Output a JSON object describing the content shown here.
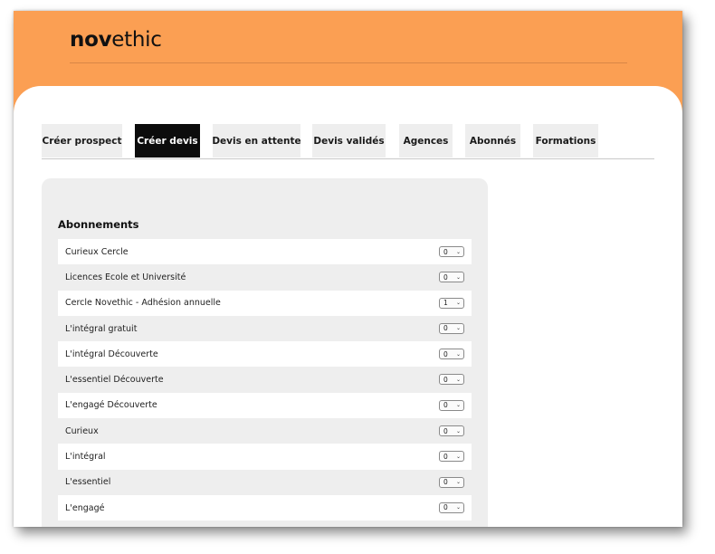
{
  "brand": {
    "logo_bold": "nov",
    "logo_rest": "ethic",
    "accent": "#fb9f53"
  },
  "tabs": [
    {
      "label": "Créer prospect",
      "active": false
    },
    {
      "label": "Créer devis",
      "active": true
    },
    {
      "label": "Devis en attente",
      "active": false
    },
    {
      "label": "Devis validés",
      "active": false
    },
    {
      "label": "Agences",
      "active": false
    },
    {
      "label": "Abonnés",
      "active": false
    },
    {
      "label": "Formations",
      "active": false
    }
  ],
  "section": {
    "title": "Abonnements",
    "items": [
      {
        "label": "Curieux Cercle",
        "qty": "0"
      },
      {
        "label": "Licences Ecole et Université",
        "qty": "0"
      },
      {
        "label": "Cercle Novethic - Adhésion annuelle",
        "qty": "1"
      },
      {
        "label": "L'intégral gratuit",
        "qty": "0"
      },
      {
        "label": "L'intégral Découverte",
        "qty": "0"
      },
      {
        "label": "L'essentiel Découverte",
        "qty": "0"
      },
      {
        "label": "L'engagé Découverte",
        "qty": "0"
      },
      {
        "label": "Curieux",
        "qty": "0"
      },
      {
        "label": "L'intégral",
        "qty": "0"
      },
      {
        "label": "L'essentiel",
        "qty": "0"
      },
      {
        "label": "L'engagé",
        "qty": "0"
      }
    ]
  }
}
